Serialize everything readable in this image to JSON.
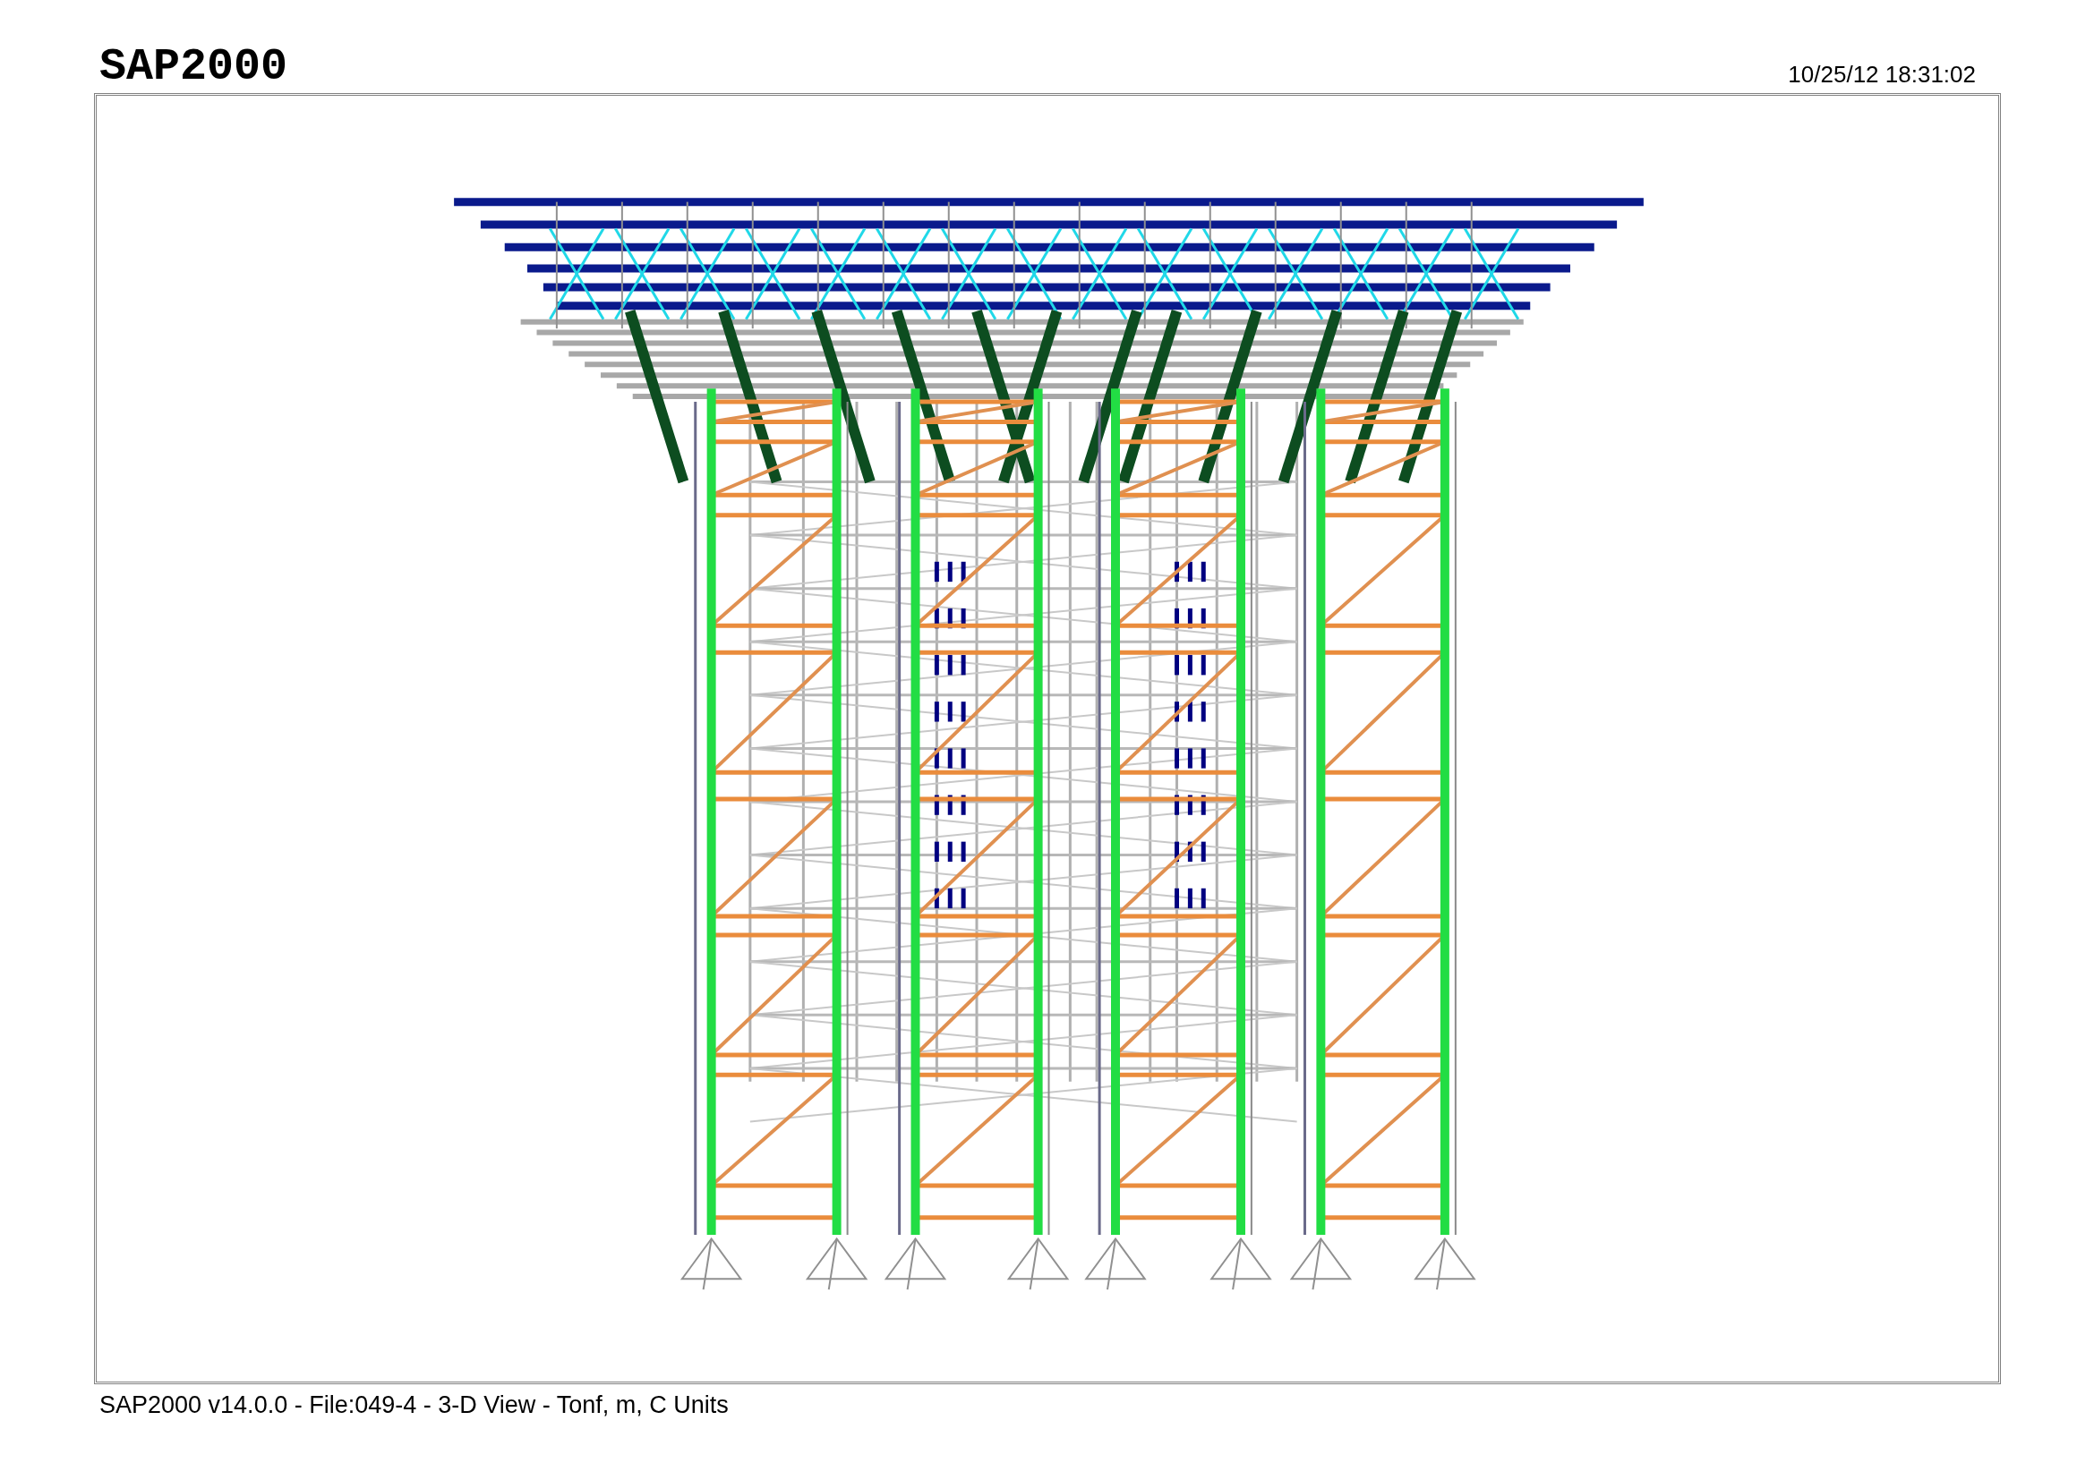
{
  "header": {
    "title": "SAP2000",
    "timestamp": "10/25/12 18:31:02"
  },
  "footer": {
    "caption": "SAP2000 v14.0.0 - File:049-4 - 3-D View - Tonf, m, C Units"
  }
}
